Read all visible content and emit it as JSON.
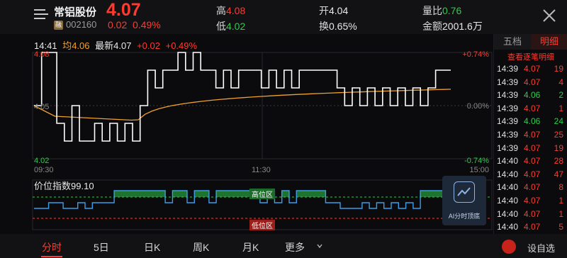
{
  "header": {
    "name": "常铝股份",
    "badge": "融",
    "code": "002160",
    "price": "4.07",
    "change": "0.02",
    "change_pct": "0.49%",
    "high_label": "高",
    "high": "4.08",
    "low_label": "低",
    "low": "4.02",
    "open_label": "开",
    "open": "4.04",
    "turnover_label": "换",
    "turnover": "0.65%",
    "vol_ratio_label": "量比",
    "vol_ratio": "0.76",
    "amount_label": "金额",
    "amount": "2001.6万"
  },
  "intraday": {
    "time": "14:41",
    "avg_label": "均",
    "avg": "4.06",
    "latest_label": "最新",
    "latest": "4.07",
    "change": "+0.02",
    "change_pct": "+0.49%",
    "y_max": "4.08",
    "y_mid": "4.05",
    "y_min": "4.02",
    "pct_max": "+0.74%",
    "pct_mid": "0.00%",
    "pct_min": "-0.74%",
    "t_start": "09:30",
    "t_mid": "11:30",
    "t_end": "15:00"
  },
  "index_panel": {
    "title": "价位指数",
    "value": "99.10",
    "high_zone": "高位区",
    "low_zone": "低位区"
  },
  "side": {
    "tab_level5": "五档",
    "tab_detail": "明细",
    "detail_link": "查看逐笔明细",
    "trades": [
      {
        "time": "14:39",
        "price": "4.07",
        "vol": "19",
        "dir": "up"
      },
      {
        "time": "14:39",
        "price": "4.07",
        "vol": "4",
        "dir": "up"
      },
      {
        "time": "14:39",
        "price": "4.06",
        "vol": "2",
        "dir": "down"
      },
      {
        "time": "14:39",
        "price": "4.07",
        "vol": "1",
        "dir": "up"
      },
      {
        "time": "14:39",
        "price": "4.06",
        "vol": "24",
        "dir": "down"
      },
      {
        "time": "14:39",
        "price": "4.07",
        "vol": "25",
        "dir": "up"
      },
      {
        "time": "14:39",
        "price": "4.07",
        "vol": "19",
        "dir": "up"
      },
      {
        "time": "14:40",
        "price": "4.07",
        "vol": "28",
        "dir": "up"
      },
      {
        "time": "14:40",
        "price": "4.07",
        "vol": "47",
        "dir": "up"
      },
      {
        "time": "14:40",
        "price": "4.07",
        "vol": "8",
        "dir": "up"
      },
      {
        "time": "14:40",
        "price": "4.07",
        "vol": "1",
        "dir": "up"
      },
      {
        "time": "14:40",
        "price": "4.07",
        "vol": "1",
        "dir": "up"
      },
      {
        "time": "14:40",
        "price": "4.07",
        "vol": "5",
        "dir": "up"
      }
    ]
  },
  "ai": {
    "label": "AI分时顶底"
  },
  "bottom": {
    "tabs": [
      "分时",
      "5日",
      "日K",
      "周K",
      "月K",
      "更多"
    ],
    "alert_label": "设自选"
  },
  "colors": {
    "up": "#ff3b30",
    "down": "#2ecc4a",
    "price_line": "#ffffff",
    "avg_line": "#f0a030",
    "index_line": "#3b9ee8",
    "high_zone": "#2ecc4a",
    "low_zone": "#ff3b30"
  }
}
